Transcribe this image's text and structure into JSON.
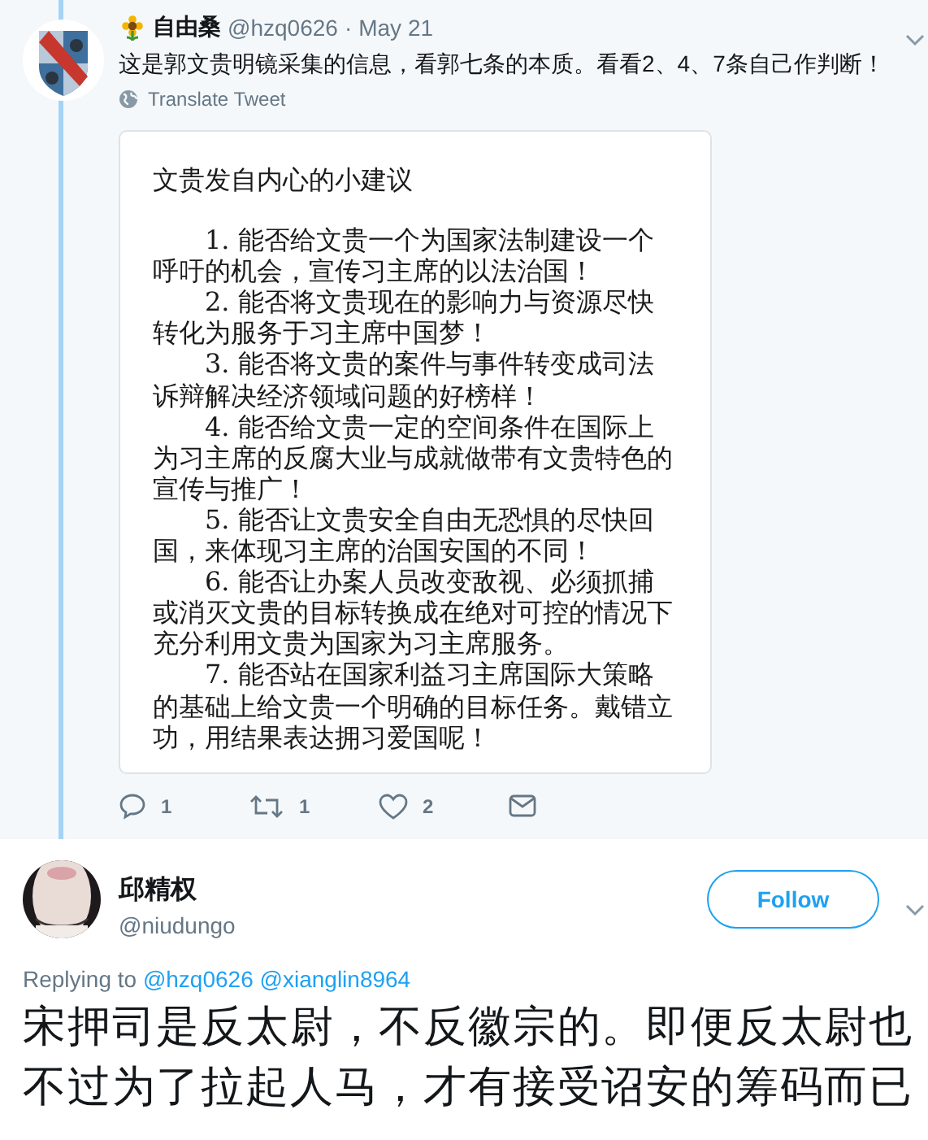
{
  "tweet": {
    "author": {
      "name": "自由桑",
      "handle": "@hzq0626",
      "separator": "·",
      "date": "May 21"
    },
    "text": "这是郭文贵明镜采集的信息，看郭七条的本质。看看2、4、7条自己作判断！",
    "translate": "Translate Tweet",
    "image_card": {
      "title": "文贵发自内心的小建议",
      "items": [
        "1. 能否给文贵一个为国家法制建设一个呼吁的机会，宣传习主席的以法治国！",
        "2. 能否将文贵现在的影响力与资源尽快转化为服务于习主席中国梦！",
        "3. 能否将文贵的案件与事件转变成司法诉辩解决经济领域问题的好榜样！",
        "4. 能否给文贵一定的空间条件在国际上为习主席的反腐大业与成就做带有文贵特色的宣传与推广！",
        "5. 能否让文贵安全自由无恐惧的尽快回国，来体现习主席的治国安国的不同！",
        "6. 能否让办案人员改变敌视、必须抓捕或消灭文贵的目标转换成在绝对可控的情况下充分利用文贵为国家为习主席服务。",
        "7. 能否站在国家利益习主席国际大策略的基础上给文贵一个明确的目标任务。戴错立功，用结果表达拥习爱国呢！"
      ]
    },
    "actions": [
      {
        "kind": "reply",
        "count": "1"
      },
      {
        "kind": "retweet",
        "count": "1"
      },
      {
        "kind": "like",
        "count": "2"
      },
      {
        "kind": "message"
      }
    ]
  },
  "reply": {
    "author": {
      "name": "邱精权",
      "handle": "@niudungo"
    },
    "follow_button": "Follow",
    "replying_to": {
      "label": "Replying to",
      "mentions": [
        "@hzq0626",
        "@xianglin8964"
      ]
    },
    "text": "宋押司是反太尉，不反徽宗的。即便反太尉也不过为了拉起人马，才有接受诏安的筹码而已"
  }
}
